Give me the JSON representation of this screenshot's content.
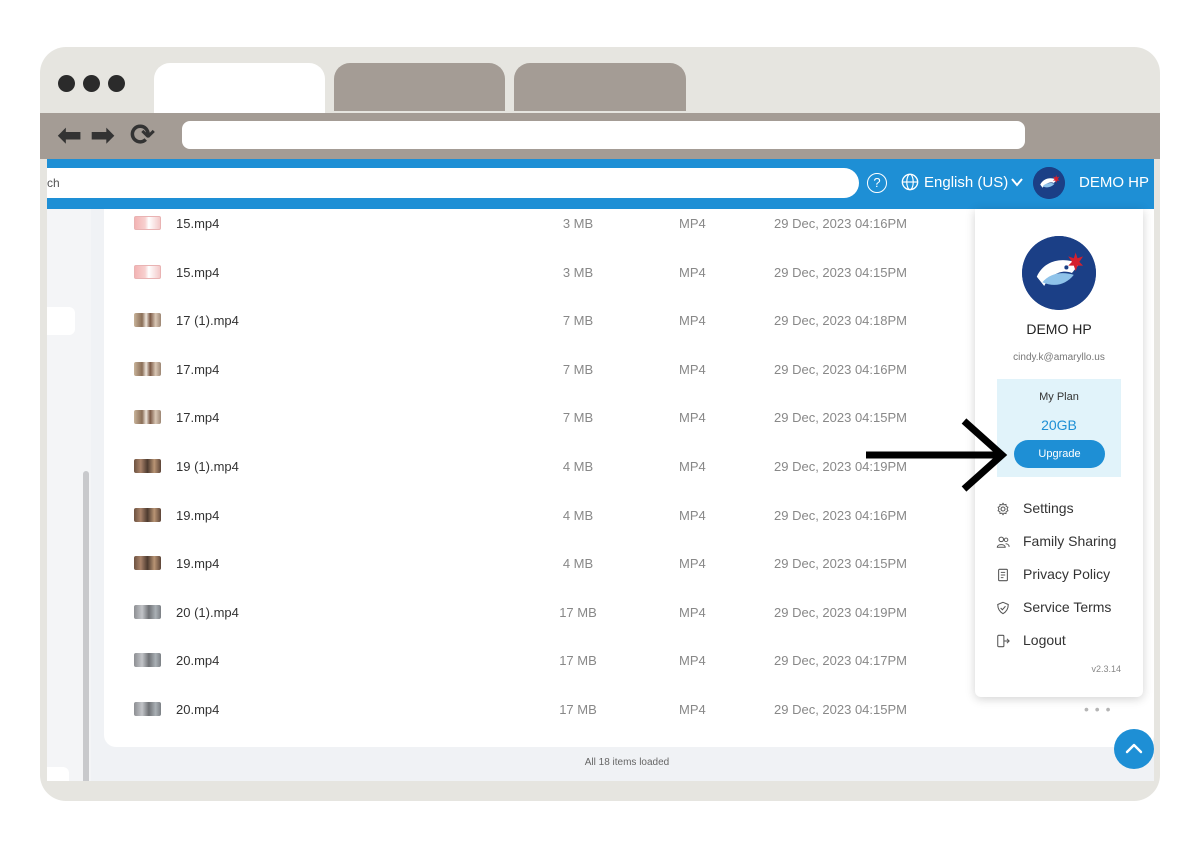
{
  "browser": {
    "nav": {
      "back_glyph": "⬅",
      "forward_glyph": "➡",
      "reload_glyph": "⟳"
    },
    "address_value": ""
  },
  "header": {
    "search_value": "ch",
    "help_glyph": "?",
    "language": "English (US)",
    "user_name": "DEMO HP",
    "accent_color": "#1e8fd5"
  },
  "files": [
    {
      "name": "15.mp4",
      "size": "3 MB",
      "type": "MP4",
      "date": "29 Dec, 2023 04:16PM",
      "thumb": "pink"
    },
    {
      "name": "15.mp4",
      "size": "3 MB",
      "type": "MP4",
      "date": "29 Dec, 2023 04:15PM",
      "thumb": "pink"
    },
    {
      "name": "17 (1).mp4",
      "size": "7 MB",
      "type": "MP4",
      "date": "29 Dec, 2023 04:18PM",
      "thumb": "person"
    },
    {
      "name": "17.mp4",
      "size": "7 MB",
      "type": "MP4",
      "date": "29 Dec, 2023 04:16PM",
      "thumb": "person"
    },
    {
      "name": "17.mp4",
      "size": "7 MB",
      "type": "MP4",
      "date": "29 Dec, 2023 04:15PM",
      "thumb": "person"
    },
    {
      "name": "19 (1).mp4",
      "size": "4 MB",
      "type": "MP4",
      "date": "29 Dec, 2023 04:19PM",
      "thumb": "dark"
    },
    {
      "name": "19.mp4",
      "size": "4 MB",
      "type": "MP4",
      "date": "29 Dec, 2023 04:16PM",
      "thumb": "dark"
    },
    {
      "name": "19.mp4",
      "size": "4 MB",
      "type": "MP4",
      "date": "29 Dec, 2023 04:15PM",
      "thumb": "dark"
    },
    {
      "name": "20 (1).mp4",
      "size": "17 MB",
      "type": "MP4",
      "date": "29 Dec, 2023 04:19PM",
      "thumb": "grey"
    },
    {
      "name": "20.mp4",
      "size": "17 MB",
      "type": "MP4",
      "date": "29 Dec, 2023 04:17PM",
      "thumb": "grey"
    },
    {
      "name": "20.mp4",
      "size": "17 MB",
      "type": "MP4",
      "date": "29 Dec, 2023 04:15PM",
      "thumb": "grey"
    }
  ],
  "row_more_glyph": "• • •",
  "status": {
    "loaded_text": "All 18 items loaded"
  },
  "dropdown": {
    "name": "DEMO HP",
    "email": "cindy.k@amaryllo.us",
    "plan_label": "My Plan",
    "plan_size": "20GB",
    "upgrade_label": "Upgrade",
    "menu": [
      {
        "label": "Settings",
        "icon": "gear-icon"
      },
      {
        "label": "Family Sharing",
        "icon": "people-icon"
      },
      {
        "label": "Privacy Policy",
        "icon": "document-icon"
      },
      {
        "label": "Service Terms",
        "icon": "shield-icon"
      },
      {
        "label": "Logout",
        "icon": "logout-icon"
      }
    ],
    "version": "v2.3.14"
  }
}
